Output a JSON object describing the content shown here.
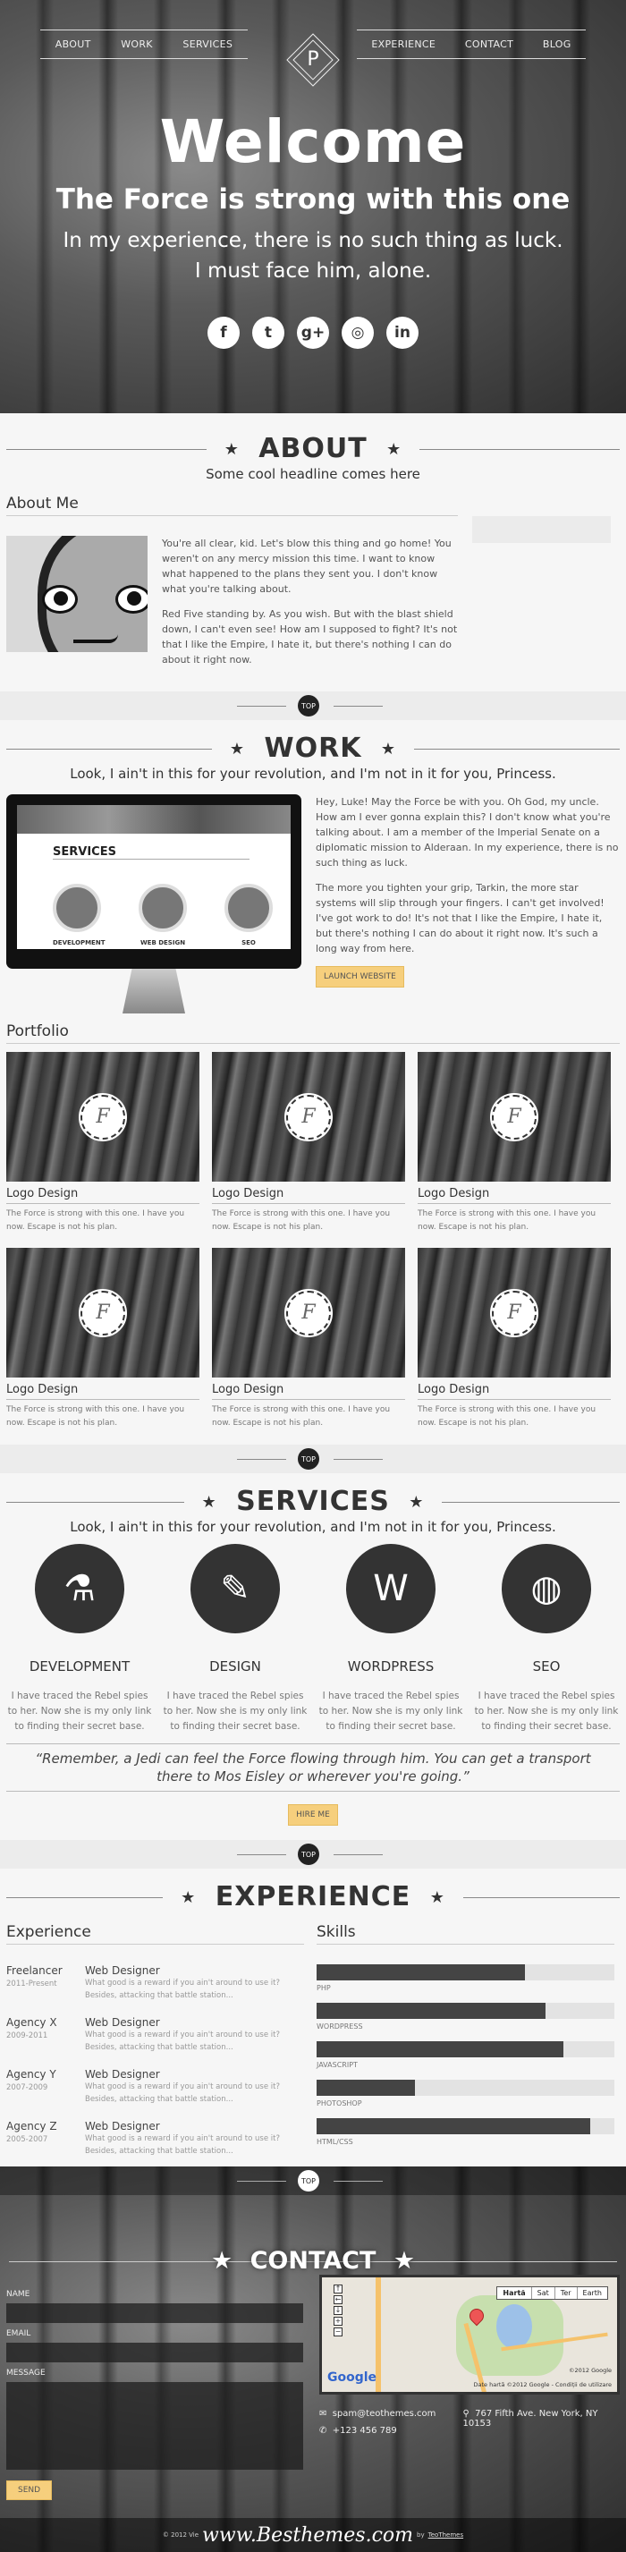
{
  "nav": {
    "left": [
      "ABOUT",
      "WORK",
      "SERVICES"
    ],
    "right": [
      "EXPERIENCE",
      "CONTACT",
      "BLOG"
    ],
    "logo_letter": "P"
  },
  "hero": {
    "title": "Welcome",
    "tagline": "The Force is strong with this one",
    "line1": "In my experience, there is no such thing as luck.",
    "line2": "I must face him, alone.",
    "social": [
      {
        "icon": "facebook-icon",
        "glyph": "f"
      },
      {
        "icon": "twitter-icon",
        "glyph": "t"
      },
      {
        "icon": "google-plus-icon",
        "glyph": "g+"
      },
      {
        "icon": "dribbble-icon",
        "glyph": "◎"
      },
      {
        "icon": "linkedin-icon",
        "glyph": "in"
      }
    ]
  },
  "about": {
    "title": "ABOUT",
    "subtitle": "Some cool headline comes here",
    "heading": "About Me",
    "p1": "You're all clear, kid. Let's blow this thing and go home! You weren't on any mercy mission this time. I want to know what happened to the plans they sent you. I don't know what you're talking about.",
    "p2": "Red Five standing by. As you wish. But with the blast shield down, I can't even see! How am I supposed to fight? It's not that I like the Empire, I hate it, but there's nothing I can do about it right now."
  },
  "top_label": "TOP",
  "star": "★",
  "work": {
    "title": "WORK",
    "subtitle": "Look, I ain't in this for your revolution, and I'm not in it for you, Princess.",
    "screen_title": "SERVICES",
    "screen_items": [
      "DEVELOPMENT",
      "WEB DESIGN",
      "SEO"
    ],
    "p1": "Hey, Luke! May the Force be with you. Oh God, my uncle. How am I ever gonna explain this? I don't know what you're talking about. I am a member of the Imperial Senate on a diplomatic mission to Alderaan. In my experience, there is no such thing as luck.",
    "p2": "The more you tighten your grip, Tarkin, the more star systems will slip through your fingers. I can't get involved! I've got work to do! It's not that I like the Empire, I hate it, but there's nothing I can do about it right now. It's such a long way from here.",
    "button": "LAUNCH WEBSITE"
  },
  "portfolio": {
    "heading": "Portfolio",
    "badge": "F",
    "items": [
      {
        "title": "Logo Design",
        "desc": "The Force is strong with this one. I have you now. Escape is not his plan."
      },
      {
        "title": "Logo Design",
        "desc": "The Force is strong with this one. I have you now. Escape is not his plan."
      },
      {
        "title": "Logo Design",
        "desc": "The Force is strong with this one. I have you now. Escape is not his plan."
      },
      {
        "title": "Logo Design",
        "desc": "The Force is strong with this one. I have you now. Escape is not his plan."
      },
      {
        "title": "Logo Design",
        "desc": "The Force is strong with this one. I have you now. Escape is not his plan."
      },
      {
        "title": "Logo Design",
        "desc": "The Force is strong with this one. I have you now. Escape is not his plan."
      }
    ]
  },
  "services": {
    "title": "SERVICES",
    "subtitle": "Look, I ain't in this for your revolution, and I'm not in it for you, Princess.",
    "items": [
      {
        "name": "DEVELOPMENT",
        "icon": "flask-icon",
        "glyph": "⚗",
        "desc": "I have traced the Rebel spies to her. Now she is my only link to finding their secret base. The"
      },
      {
        "name": "DESIGN",
        "icon": "paintbrush-icon",
        "glyph": "✎",
        "desc": "I have traced the Rebel spies to her. Now she is my only link to finding their secret base. The"
      },
      {
        "name": "WORDPRESS",
        "icon": "wordpress-icon",
        "glyph": "W",
        "desc": "I have traced the Rebel spies to her. Now she is my only link to finding their secret base. The"
      },
      {
        "name": "SEO",
        "icon": "globe-icon",
        "glyph": "◍",
        "desc": "I have traced the Rebel spies to her. Now she is my only link to finding their secret base. The"
      }
    ],
    "quote": "“Remember, a Jedi can feel the Force flowing through him. You can get a transport there to Mos Eisley or wherever you're going.”",
    "button": "HIRE ME"
  },
  "experience": {
    "title": "EXPERIENCE",
    "exp_heading": "Experience",
    "skills_heading": "Skills",
    "jobs": [
      {
        "company": "Freelancer",
        "years": "2011-Present",
        "role": "Web Designer",
        "desc": "What good is a reward if you ain't around to use it? Besides, attacking that battle station..."
      },
      {
        "company": "Agency X",
        "years": "2009-2011",
        "role": "Web Designer",
        "desc": "What good is a reward if you ain't around to use it? Besides, attacking that battle station..."
      },
      {
        "company": "Agency Y",
        "years": "2007-2009",
        "role": "Web Designer",
        "desc": "What good is a reward if you ain't around to use it? Besides, attacking that battle station..."
      },
      {
        "company": "Agency Z",
        "years": "2005-2007",
        "role": "Web Designer",
        "desc": "What good is a reward if you ain't around to use it? Besides, attacking that battle station..."
      }
    ],
    "skills": [
      {
        "name": "PHP",
        "percent": 70
      },
      {
        "name": "WORDPRESS",
        "percent": 77
      },
      {
        "name": "JAVASCRIPT",
        "percent": 83
      },
      {
        "name": "PHOTOSHOP",
        "percent": 33
      },
      {
        "name": "HTML/CSS",
        "percent": 92
      }
    ]
  },
  "contact": {
    "title": "CONTACT",
    "name_label": "NAME",
    "email_label": "EMAIL",
    "message_label": "MESSAGE",
    "send": "SEND",
    "map": {
      "types": [
        "Hartă",
        "Sat",
        "Ter",
        "Earth"
      ],
      "powered": "Google",
      "copyright": "©2012 Google",
      "data": "Date hartă ©2012 Google - Condiții de utilizare",
      "marker": "A"
    },
    "email": "spam@teothemes.com",
    "phone": "+123 456 789",
    "address": "767 Fifth Ave. New York, NY 10153"
  },
  "footer": {
    "copyright": "© 2012 Vie",
    "brand": "www.Besthemes.com",
    "by": "by",
    "author": "TeoThemes"
  }
}
